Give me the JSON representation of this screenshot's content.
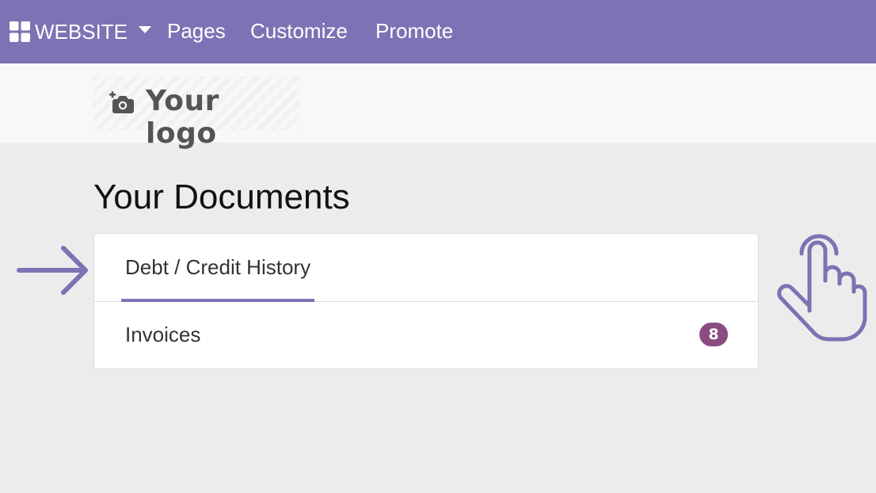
{
  "topbar": {
    "website_label": "WEBSITE",
    "pages_label": "Pages",
    "customize_label": "Customize",
    "promote_label": "Promote",
    "icons": {
      "apps": "apps-grid-icon",
      "caret": "caret-down-icon"
    },
    "color": "#7c73b5"
  },
  "header": {
    "logo_text": "Your logo",
    "logo_icon": "camera-add-icon"
  },
  "main": {
    "title": "Your Documents",
    "documents": [
      {
        "label": "Debt / Credit History",
        "active": true
      },
      {
        "label": "Invoices",
        "badge": "8"
      }
    ],
    "badge_color": "#8a4c82"
  },
  "annotations": {
    "arrow_icon": "arrow-right-icon",
    "hand_icon": "pointing-hand-icon",
    "color": "#7c73b5"
  }
}
